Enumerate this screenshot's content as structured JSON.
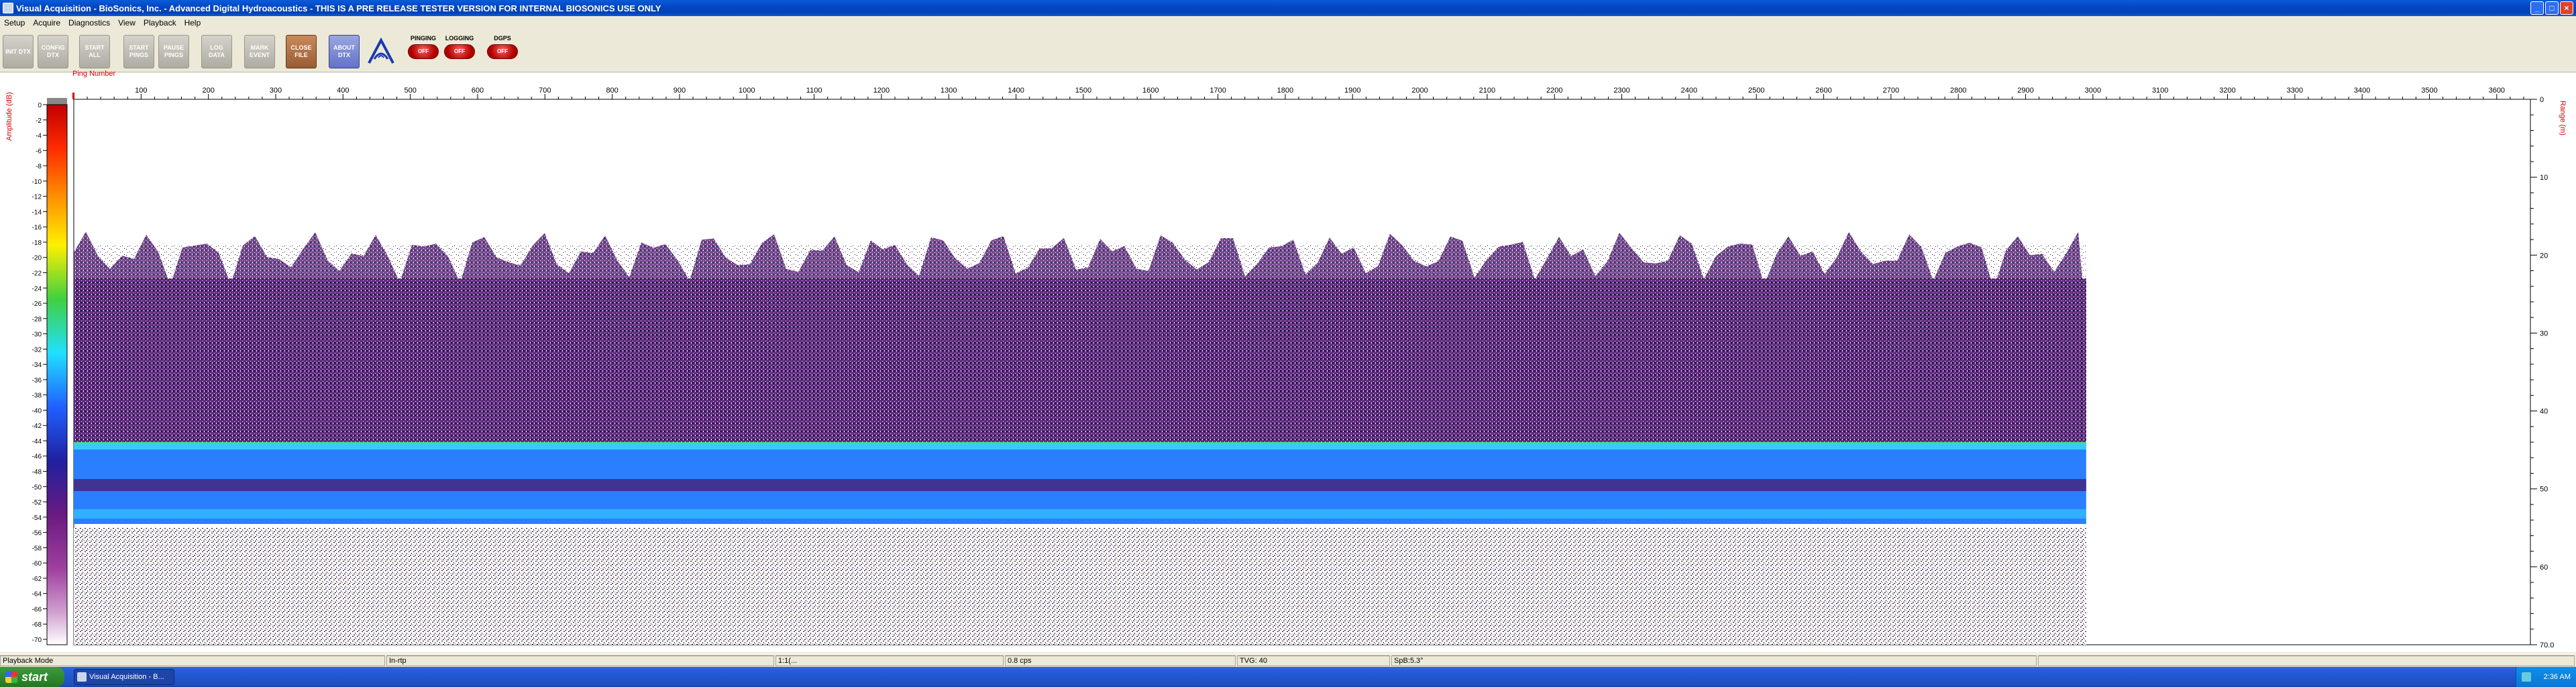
{
  "window": {
    "title": "Visual Acquisition  -  BioSonics, Inc.  -  Advanced Digital Hydroacoustics  -  THIS IS A PRE RELEASE TESTER VERSION FOR INTERNAL BIOSONICS USE ONLY",
    "minimize_label": "_",
    "maximize_label": "□",
    "close_label": "×"
  },
  "menu": [
    "Setup",
    "Acquire",
    "Diagnostics",
    "View",
    "Playback",
    "Help"
  ],
  "toolbar": {
    "buttons": [
      {
        "label": "INIT DTX",
        "state": "disabled"
      },
      {
        "label": "CONFIG DTX",
        "state": "disabled"
      },
      {
        "label": "START ALL",
        "state": "disabled"
      },
      {
        "label": "START PINGS",
        "state": "disabled"
      },
      {
        "label": "PAUSE PINGS",
        "state": "disabled"
      },
      {
        "label": "LOG DATA",
        "state": "disabled"
      },
      {
        "label": "MARK EVENT",
        "state": "disabled"
      },
      {
        "label": "CLOSE FILE",
        "state": "active"
      },
      {
        "label": "ABOUT DTX",
        "state": "about"
      }
    ],
    "indicators": [
      {
        "label": "PINGING",
        "value": "OFF"
      },
      {
        "label": "LOGGING",
        "value": "OFF"
      },
      {
        "label": "DGPS",
        "value": "OFF"
      }
    ]
  },
  "echogram": {
    "ping_axis_label": "Ping Number",
    "amplitude_axis_label": "Amplitude (dB)",
    "range_axis_label": "Range (m)",
    "ping_ticks": [
      100,
      200,
      300,
      400,
      500,
      600,
      700,
      800,
      900,
      1000,
      1100,
      1200,
      1300,
      1400,
      1500,
      1600,
      1700,
      1800,
      1900,
      2000,
      2100,
      2200,
      2300,
      2400,
      2500,
      2600,
      2700,
      2800,
      2900,
      3000,
      3100,
      3200,
      3300,
      3400,
      3500,
      3600
    ],
    "ping_max": 3650,
    "pings_recorded": 2990,
    "amplitude_ticks": [
      "0",
      "-2",
      "-4",
      "-6",
      "-8",
      "-10",
      "-12",
      "-14",
      "-16",
      "-18",
      "-20",
      "-22",
      "-24",
      "-26",
      "-28",
      "-30",
      "-32",
      "-34",
      "-36",
      "-38",
      "-40",
      "-42",
      "-44",
      "-46",
      "-48",
      "-50",
      "-52",
      "-54",
      "-56",
      "-58",
      "-60",
      "-62",
      "-64",
      "-66",
      "-68",
      "-70"
    ],
    "amplitude_range": [
      0,
      -70
    ],
    "range_ticks": [
      "0",
      "10",
      "20",
      "30",
      "40",
      "50",
      "60",
      "70.0"
    ],
    "range_max_m": 70,
    "bands": {
      "noise_top_m": 18.5,
      "water_column_m": [
        23,
        44
      ],
      "bottom_m": [
        44,
        54.5
      ],
      "lower_noise_m": [
        55,
        70
      ]
    },
    "colors": {
      "bottom_line": "#3fe08a",
      "bottom_core": "#2a7fff",
      "bottom_bright": "#37d8ff",
      "water_column": "#4a1a6e",
      "background": "#ffffff"
    }
  },
  "statusbar": {
    "mode": "Playback Mode",
    "segments": [
      "In-rtp",
      "1:1(...",
      "0.8 cps",
      "TVG: 40",
      "SpB:5.3°"
    ]
  },
  "taskbar": {
    "start_label": "start",
    "task_label": "Visual Acquisition - B...",
    "clock": "2:36 AM"
  }
}
